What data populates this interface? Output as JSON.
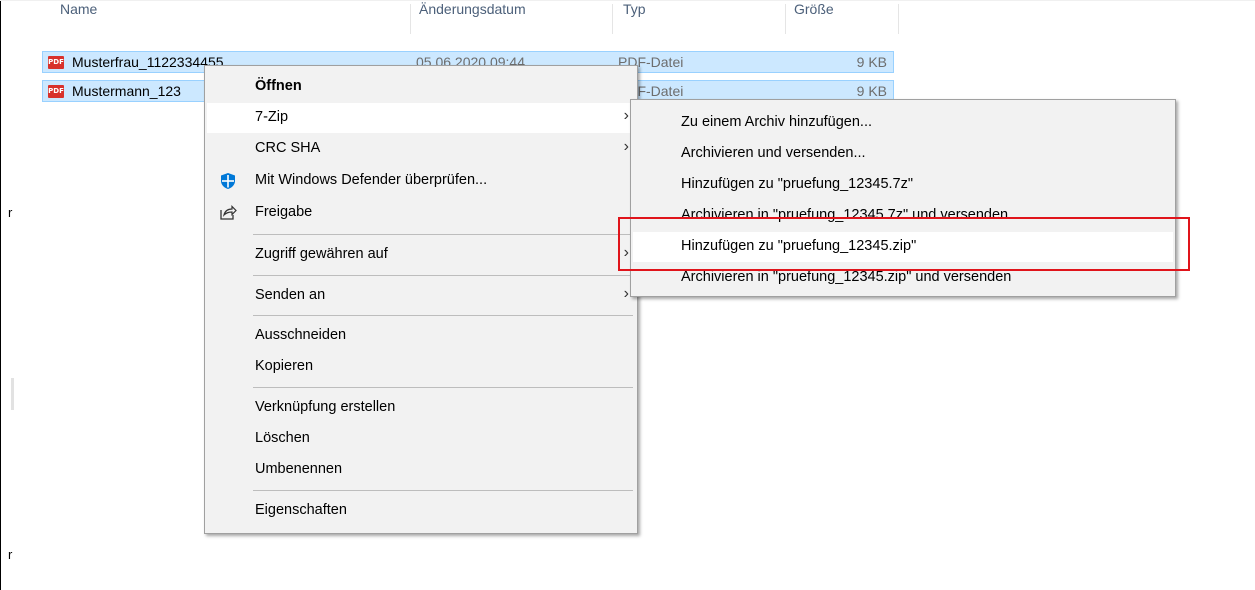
{
  "columns": {
    "name": "Name",
    "date": "Änderungsdatum",
    "type": "Typ",
    "size": "Größe"
  },
  "files": [
    {
      "icon": "pdf-icon",
      "icon_label": "PDF",
      "name": "Musterfrau_1122334455",
      "date": "05.06.2020 09:44",
      "type": "PDF-Datei",
      "size": "9 KB"
    },
    {
      "icon": "pdf-icon",
      "icon_label": "PDF",
      "name": "Mustermann_123",
      "date": "",
      "type": "PDF-Datei",
      "size": "9 KB"
    }
  ],
  "context_menu": {
    "items": [
      {
        "label": "Öffnen",
        "bold": true
      },
      {
        "label": "7-Zip",
        "submenu": true,
        "hover": true
      },
      {
        "label": "CRC SHA",
        "submenu": true
      },
      {
        "label": "Mit Windows Defender überprüfen...",
        "icon": "windows-defender-icon"
      },
      {
        "label": "Freigabe",
        "icon": "share-icon"
      },
      {
        "label": "Zugriff gewähren auf",
        "submenu": true
      },
      {
        "label": "Senden an",
        "submenu": true
      },
      {
        "label": "Ausschneiden"
      },
      {
        "label": "Kopieren"
      },
      {
        "label": "Verknüpfung erstellen"
      },
      {
        "label": "Löschen"
      },
      {
        "label": "Umbenennen"
      },
      {
        "label": "Eigenschaften"
      }
    ]
  },
  "zip_submenu": {
    "items": [
      {
        "label": "Zu einem Archiv hinzufügen..."
      },
      {
        "label": "Archivieren und versenden..."
      },
      {
        "label": "Hinzufügen zu \"pruefung_12345.7z\""
      },
      {
        "label": "Archivieren in \"pruefung_12345.7z\" und versenden"
      },
      {
        "label": "Hinzufügen zu \"pruefung_12345.zip\"",
        "hover": true
      },
      {
        "label": "Archivieren in \"pruefung_12345.zip\" und versenden"
      }
    ]
  },
  "edge_chars": [
    "r",
    "r"
  ],
  "colors": {
    "selection": "#cce8ff",
    "selection_border": "#99d1ff",
    "menu_bg": "#f2f2f2",
    "highlight": "#e0141b",
    "header_text": "#4c607a"
  }
}
